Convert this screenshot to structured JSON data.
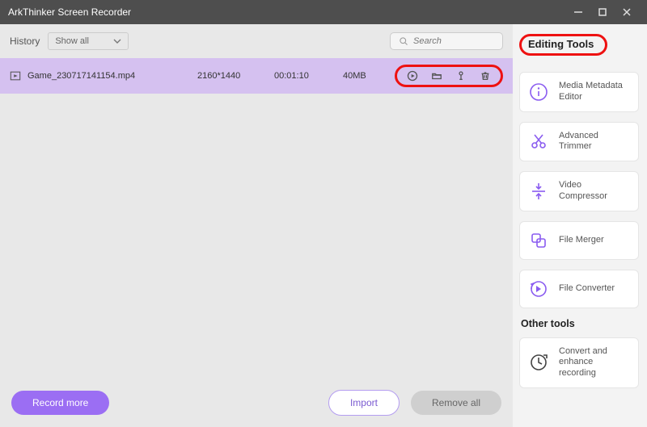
{
  "window": {
    "title": "ArkThinker Screen Recorder"
  },
  "history": {
    "label": "History",
    "selected": "Show all"
  },
  "search": {
    "placeholder": "Search"
  },
  "files": [
    {
      "name": "Game_230717141154.mp4",
      "resolution": "2160*1440",
      "duration": "00:01:10",
      "size": "40MB"
    }
  ],
  "actions": {
    "record_more": "Record more",
    "import": "Import",
    "remove_all": "Remove all"
  },
  "side": {
    "editing_tools": "Editing Tools",
    "tools": [
      "Media Metadata Editor",
      "Advanced Trimmer",
      "Video Compressor",
      "File Merger",
      "File Converter"
    ],
    "other_heading": "Other tools",
    "other_tools": [
      "Convert and enhance recording"
    ]
  }
}
